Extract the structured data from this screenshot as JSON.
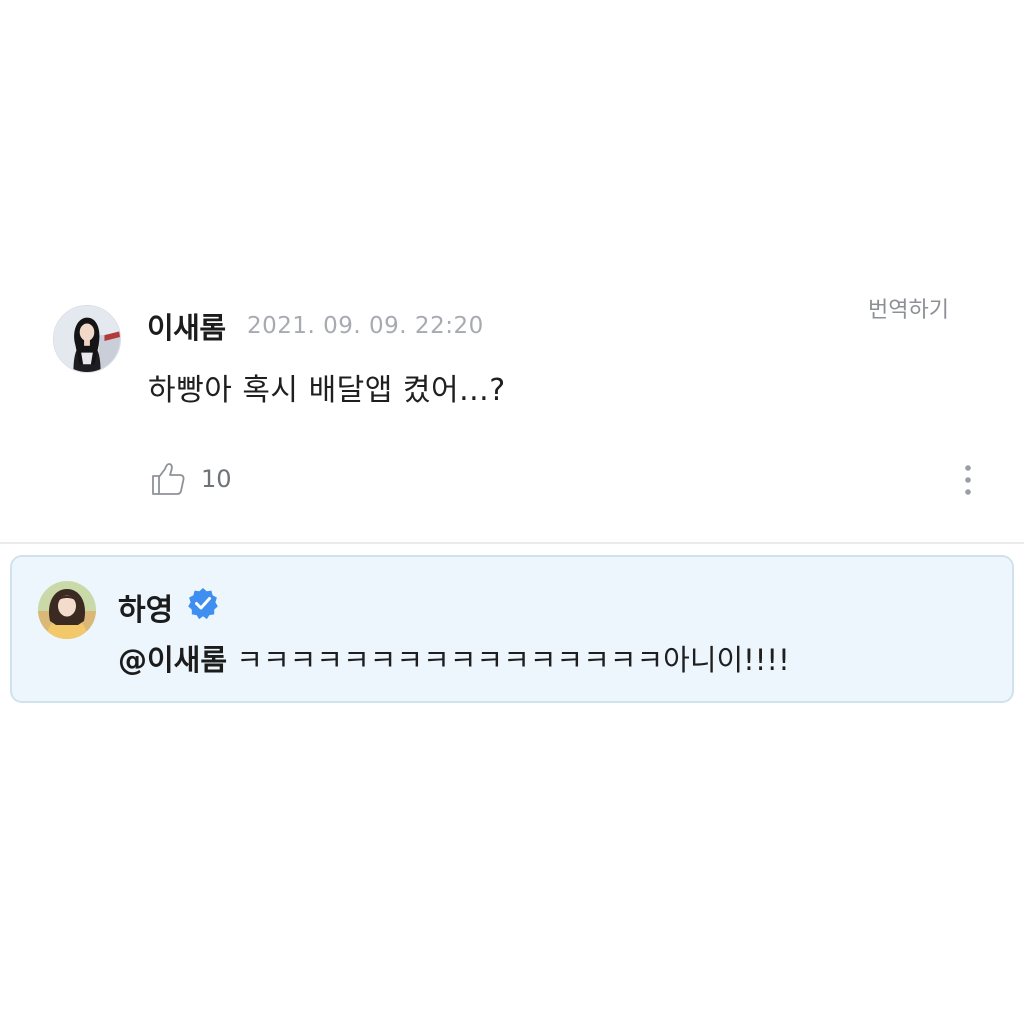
{
  "comment": {
    "author": "이새롬",
    "timestamp": "2021. 09. 09. 22:20",
    "translate_label": "번역하기",
    "text": "하빵아 혹시 배달앱 켰어...?",
    "like_count": "10",
    "avatar": "profile-photo",
    "like_icon": "thumbs-up-icon",
    "more_icon": "vertical-ellipsis-icon"
  },
  "reply": {
    "author": "하영",
    "verified_icon": "verified-badge-icon",
    "verified_color": "#3f8ff0",
    "mention": "@이새롬",
    "text": "ㅋㅋㅋㅋㅋㅋㅋㅋㅋㅋㅋㅋㅋㅋㅋㅋ아니이!!!!",
    "avatar": "profile-photo",
    "background_color": "#ecf6fc"
  }
}
